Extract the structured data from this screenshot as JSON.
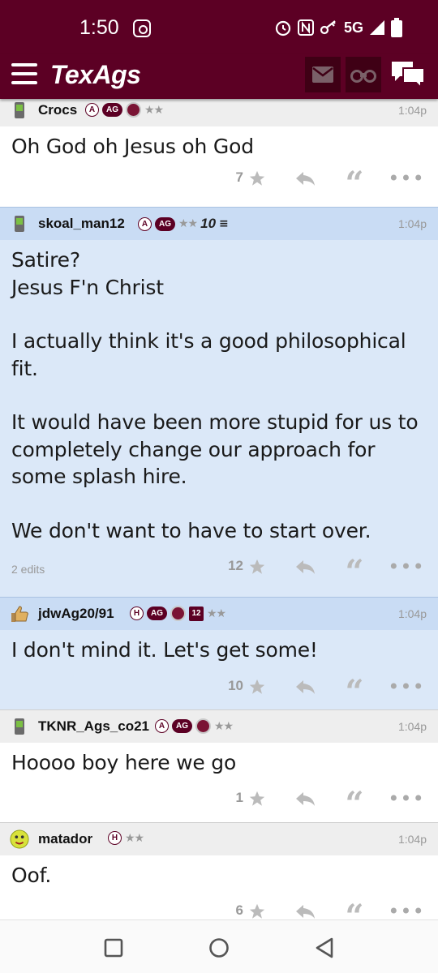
{
  "status_bar": {
    "time": "1:50",
    "network": "5G"
  },
  "header": {
    "logo": "TexAgs"
  },
  "posts": [
    {
      "username": "Crocs",
      "badges": [
        "A",
        "AG"
      ],
      "time": "1:04p",
      "body": [
        "Oh God oh Jesus oh God"
      ],
      "stars": "7",
      "edits": ""
    },
    {
      "username": "skoal_man12",
      "badges": [
        "A",
        "AG",
        "10"
      ],
      "time": "1:04p",
      "body": [
        "Satire?\nJesus F'n Christ",
        "I actually think it's a good philosophical fit.",
        "It would have been more stupid for us to completely change our approach for some splash hire.",
        "We don't want to have to start over."
      ],
      "stars": "12",
      "edits": "2 edits"
    },
    {
      "username": "jdwAg20/91",
      "badges": [
        "H",
        "AG",
        "12"
      ],
      "time": "1:04p",
      "body": [
        "I don't mind it. Let's get some!"
      ],
      "stars": "10",
      "edits": ""
    },
    {
      "username": "TKNR_Ags_co21",
      "badges": [
        "A",
        "AG"
      ],
      "time": "1:04p",
      "body": [
        "Hoooo boy here we go"
      ],
      "stars": "1",
      "edits": ""
    },
    {
      "username": "matador",
      "badges": [
        "H"
      ],
      "time": "1:04p",
      "body": [
        "Oof."
      ],
      "stars": "6",
      "edits": ""
    }
  ],
  "colors": {
    "maroon": "#5c0024",
    "highlight": "#dbe8f8",
    "header_highlight": "#c9dcf4"
  }
}
